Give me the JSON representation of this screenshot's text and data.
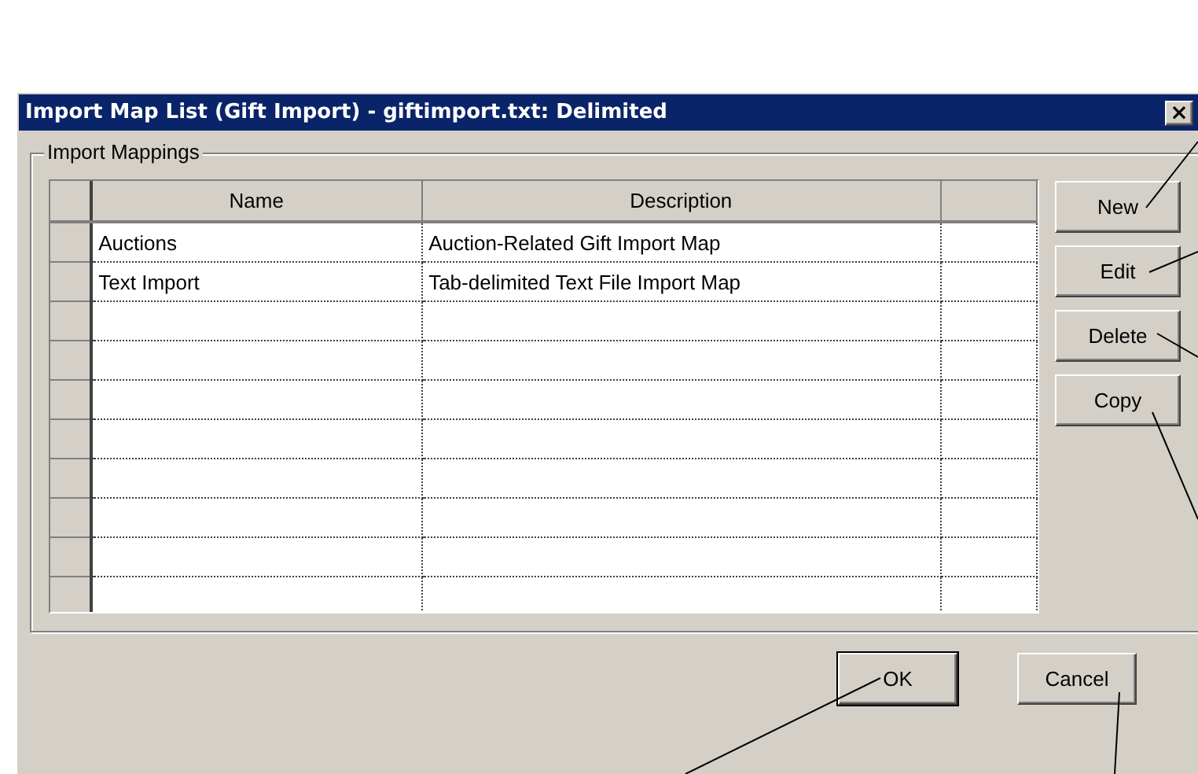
{
  "window": {
    "title": "Import Map List (Gift Import) - giftimport.txt: Delimited",
    "close": "×"
  },
  "group": {
    "label": "Import Mappings"
  },
  "table": {
    "columns": [
      "Name",
      "Description"
    ],
    "rows": [
      {
        "name": "Auctions",
        "description": "Auction-Related Gift Import Map"
      },
      {
        "name": "Text Import",
        "description": "Tab-delimited Text File Import Map"
      },
      {},
      {},
      {},
      {},
      {},
      {},
      {},
      {}
    ]
  },
  "side_buttons": [
    {
      "label": "New"
    },
    {
      "label": "Edit"
    },
    {
      "label": "Delete"
    },
    {
      "label": "Copy"
    }
  ],
  "buttons": [
    {
      "label": "OK",
      "default": true
    },
    {
      "label": "Cancel",
      "default": false
    }
  ]
}
